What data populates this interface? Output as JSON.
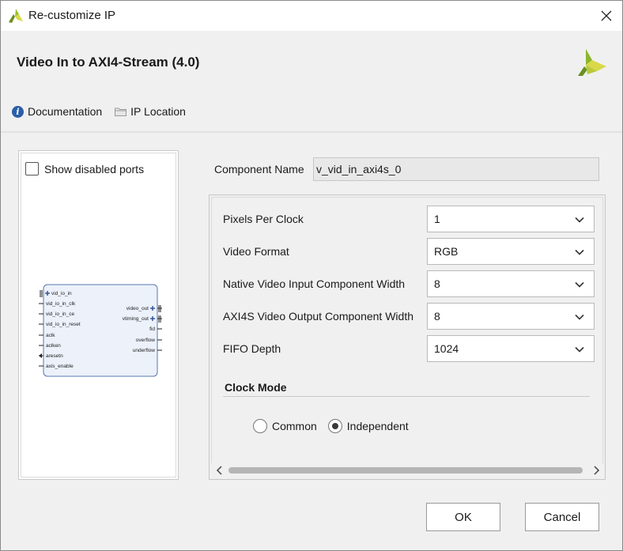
{
  "window": {
    "title": "Re-customize IP"
  },
  "header": {
    "ip_title": "Video In to AXI4-Stream (4.0)",
    "documentation_label": "Documentation",
    "ip_location_label": "IP Location"
  },
  "symbol_panel": {
    "show_disabled_label": "Show disabled ports",
    "show_disabled_checked": false,
    "ports_left": [
      "vid_io_in",
      "vid_io_in_clk",
      "vid_io_in_ce",
      "vid_io_in_reset",
      "aclk",
      "aclken",
      "aresetn",
      "axis_enable"
    ],
    "ports_right": [
      "video_out",
      "vtiming_out",
      "fid",
      "overflow",
      "underflow"
    ]
  },
  "component": {
    "label": "Component Name",
    "value": "v_vid_in_axi4s_0"
  },
  "params": [
    {
      "label": "Pixels Per Clock",
      "value": "1"
    },
    {
      "label": "Video Format",
      "value": "RGB"
    },
    {
      "label": "Native Video Input Component Width",
      "value": "8"
    },
    {
      "label": "AXI4S Video Output Component Width",
      "value": "8"
    },
    {
      "label": "FIFO Depth",
      "value": "1024"
    }
  ],
  "clock_mode": {
    "title": "Clock Mode",
    "options": [
      "Common",
      "Independent"
    ],
    "selected": "Independent"
  },
  "buttons": {
    "ok": "OK",
    "cancel": "Cancel"
  },
  "colors": {
    "brand_green": "#7aa72a",
    "brand_yellow": "#d6d84a",
    "block_fill": "#ecf1fa",
    "block_border": "#5a78b0"
  }
}
